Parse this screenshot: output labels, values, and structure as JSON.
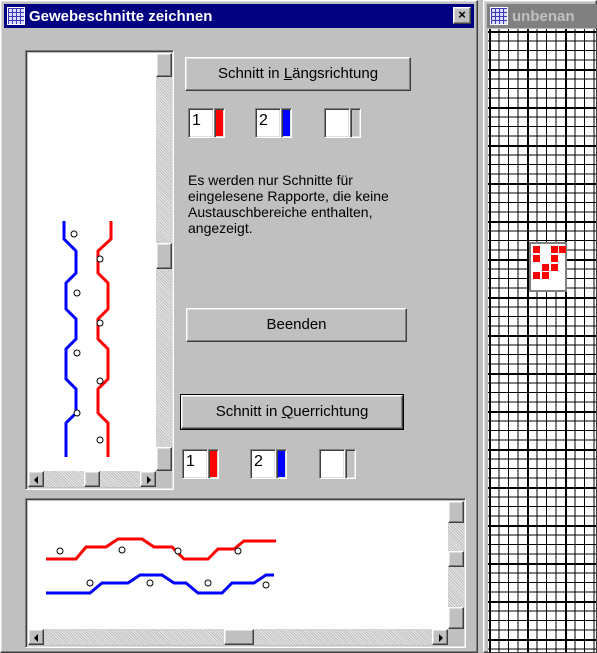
{
  "dialog": {
    "title": "Gewebeschnitte zeichnen",
    "close_glyph": "×",
    "btn_laengs_pre": "Schnitt in ",
    "btn_laengs_key": "L",
    "btn_laengs_post": "ängsrichtung",
    "btn_quer_pre": "Schnitt in ",
    "btn_quer_key": "Q",
    "btn_quer_post": "uerrichtung",
    "btn_beenden": "Beenden",
    "info_text": "Es werden nur Schnitte für eingelesene Rapporte, die keine Austauschbereiche enthalten, angezeigt.",
    "top_swatches": [
      {
        "num": "1",
        "color": "#ff0000"
      },
      {
        "num": "2",
        "color": "#0000ff"
      },
      {
        "num": "",
        "color": "#c0c0c0"
      }
    ],
    "bottom_swatches": [
      {
        "num": "1",
        "color": "#ff0000"
      },
      {
        "num": "2",
        "color": "#0000ff"
      },
      {
        "num": "",
        "color": "#c0c0c0"
      }
    ],
    "thread_colors": {
      "weft1": "#ff0000",
      "weft2": "#0000ff"
    }
  },
  "grid_window": {
    "title": "unbenan",
    "rapport_color": "#ff0000"
  }
}
